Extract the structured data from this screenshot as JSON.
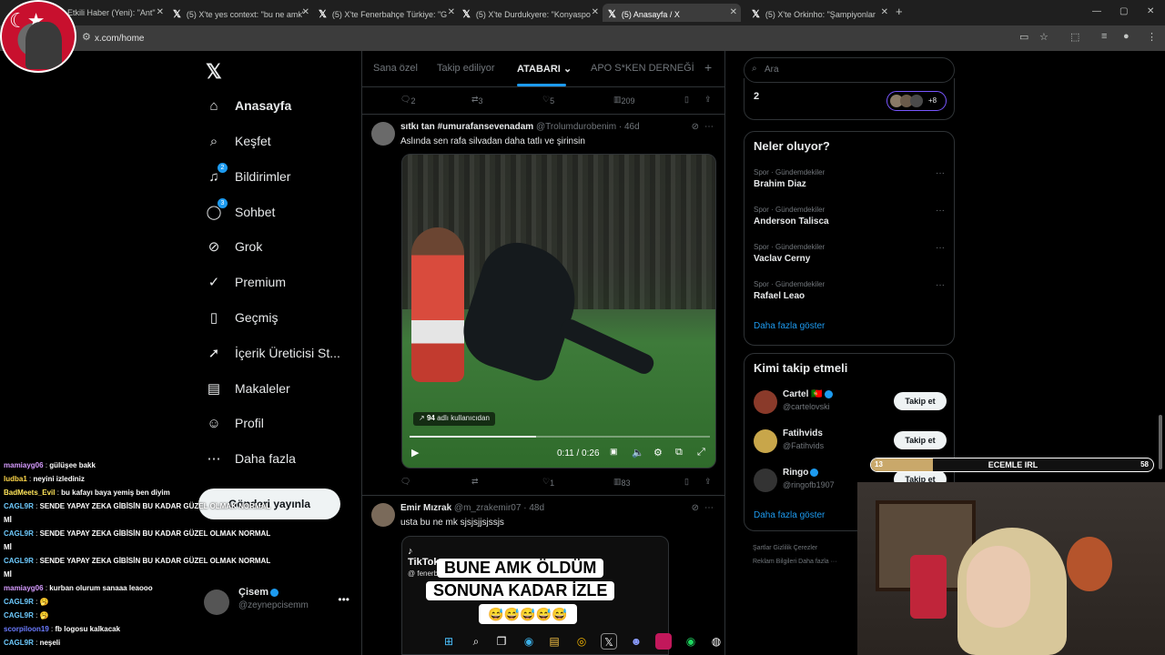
{
  "browser": {
    "tabs": [
      {
        "label": "Etkili Haber (Yeni): \"Ant\"",
        "active": false
      },
      {
        "label": "(5) X'te yes context: \"bu ne amk\"",
        "active": false
      },
      {
        "label": "(5) X'te Fenerbahçe Türkiye: \"G",
        "active": false
      },
      {
        "label": "(5) X'te Durdukyere: \"Konyaspo",
        "active": false
      },
      {
        "label": "(5) Anasayfa / X",
        "active": true
      },
      {
        "label": "(5) X'te Orkinho: \"Şampiyonlar",
        "active": false
      }
    ],
    "url": "x.com/home"
  },
  "sidebar": {
    "items": [
      {
        "label": "Anasayfa",
        "icon": "home-icon",
        "glyph": "⌂"
      },
      {
        "label": "Keşfet",
        "icon": "search-icon",
        "glyph": "⌕"
      },
      {
        "label": "Bildirimler",
        "icon": "bell-icon",
        "glyph": "♫",
        "badge": "2"
      },
      {
        "label": "Sohbet",
        "icon": "chat-icon",
        "glyph": "◯",
        "badge": "3"
      },
      {
        "label": "Grok",
        "icon": "grok-icon",
        "glyph": "⊘"
      },
      {
        "label": "Premium",
        "icon": "premium-icon",
        "glyph": "✓"
      },
      {
        "label": "Geçmiş",
        "icon": "bookmark-icon",
        "glyph": "▯"
      },
      {
        "label": "İçerik Üreticisi St...",
        "icon": "rocket-icon",
        "glyph": "➚"
      },
      {
        "label": "Makaleler",
        "icon": "article-icon",
        "glyph": "▤"
      },
      {
        "label": "Profil",
        "icon": "profile-icon",
        "glyph": "☺"
      },
      {
        "label": "Daha fazla",
        "icon": "more-icon",
        "glyph": "⋯"
      }
    ],
    "post_button": "Gönderi yayınla",
    "me": {
      "name": "Çisem",
      "handle": "@zeynepcisemm"
    }
  },
  "feed": {
    "tabs": [
      "Sana özel",
      "Takip ediliyor",
      "ATABARI",
      "APO S*KEN DERNEĞİ"
    ],
    "top_actions": {
      "replies": "2",
      "reposts": "3",
      "likes": "5",
      "views": "209"
    },
    "tweet1": {
      "name": "sıtkı tan #umurafansevenadam",
      "handle": "@Trolumdurobenim",
      "time": "46d",
      "text": "Aslında sen rafa silvadan daha tatlı ve şirinsin",
      "video": {
        "views_count": "94",
        "views_label": "adlı kullanıcıdan",
        "time": "0:11 / 0:26",
        "progress": 0.42
      },
      "actions": {
        "replies": "",
        "reposts": "",
        "likes": "1",
        "views": "83"
      }
    },
    "tweet2": {
      "name": "Emir Mızrak",
      "handle": "@m_zrakemir07",
      "time": "48d",
      "text": "usta bu ne mk sjsjsjjsjssjs",
      "media": {
        "logo": "TikTok",
        "sub": "@ fenerb",
        "line1": "BUNE AMK ÖLDÜM",
        "line2": "SONUNA KADAR İZLE",
        "emoji": "😅😅😅😅😅"
      }
    }
  },
  "right": {
    "search_placeholder": "Ara",
    "top_panel": {
      "count": "2",
      "more": "+8"
    },
    "trends_title": "Neler oluyor?",
    "trends": [
      {
        "meta": "Spor · Gündemdekiler",
        "name": "Brahim Diaz"
      },
      {
        "meta": "Spor · Gündemdekiler",
        "name": "Anderson Talisca"
      },
      {
        "meta": "Spor · Gündemdekiler",
        "name": "Vaclav Cerny"
      },
      {
        "meta": "Spor · Gündemdekiler",
        "name": "Rafael Leao"
      }
    ],
    "show_more": "Daha fazla göster",
    "who_title": "Kimi takip etmeli",
    "follows": [
      {
        "name": "Cartel 🇵🇹",
        "handle": "@cartelovski",
        "btn": "Takip et"
      },
      {
        "name": "Fatihvids",
        "handle": "@Fatihvids",
        "btn": "Takip et"
      },
      {
        "name": "Ringo",
        "handle": "@ringofb1907",
        "btn": "Takip et"
      }
    ],
    "show_more2": "Daha fazla göster",
    "footer1": "Şartlar     Gizlilik     Çerezler",
    "footer2": "Reklam Bilgileri     Daha fazla ···"
  },
  "stream": {
    "bar_left": "13",
    "bar_center": "ECEMLE IRL",
    "bar_right": "58",
    "bar_progress": 0.22
  },
  "chat": [
    {
      "user": "mamiayg06",
      "color": "#d69bff",
      "msg": "gülüşee bakk"
    },
    {
      "user": "ludba1",
      "color": "#ffd84a",
      "msg": "neyini izlediniz"
    },
    {
      "user": "BadMeets_Evil",
      "color": "#ffe55a",
      "msg": "bu kafayı baya yemiş ben diyim"
    },
    {
      "user": "CAGL9R",
      "color": "#6ecbff",
      "msg": "SENDE YAPAY ZEKA GİBİSİN BU KADAR GÜZEL OLMAK NORMAL"
    },
    {
      "user": "",
      "color": "#fff",
      "msg": "Mİ"
    },
    {
      "user": "CAGL9R",
      "color": "#6ecbff",
      "msg": "SENDE YAPAY ZEKA GİBİSİN BU KADAR GÜZEL OLMAK NORMAL"
    },
    {
      "user": "",
      "color": "#fff",
      "msg": "Mİ"
    },
    {
      "user": "CAGL9R",
      "color": "#6ecbff",
      "msg": "SENDE YAPAY ZEKA GİBİSİN BU KADAR GÜZEL OLMAK NORMAL"
    },
    {
      "user": "",
      "color": "#fff",
      "msg": "Mİ"
    },
    {
      "user": "mamiayg06",
      "color": "#d69bff",
      "msg": "kurban olurum sanaaa leaooo"
    },
    {
      "user": "CAGL9R",
      "color": "#6ecbff",
      "msg": "🥱"
    },
    {
      "user": "CAGL9R",
      "color": "#6ecbff",
      "msg": "🥱"
    },
    {
      "user": "scorpiloon19",
      "color": "#6b7bff",
      "msg": "fb logosu kalkacak"
    },
    {
      "user": "CAGL9R",
      "color": "#6ecbff",
      "msg": "neşeli"
    }
  ]
}
